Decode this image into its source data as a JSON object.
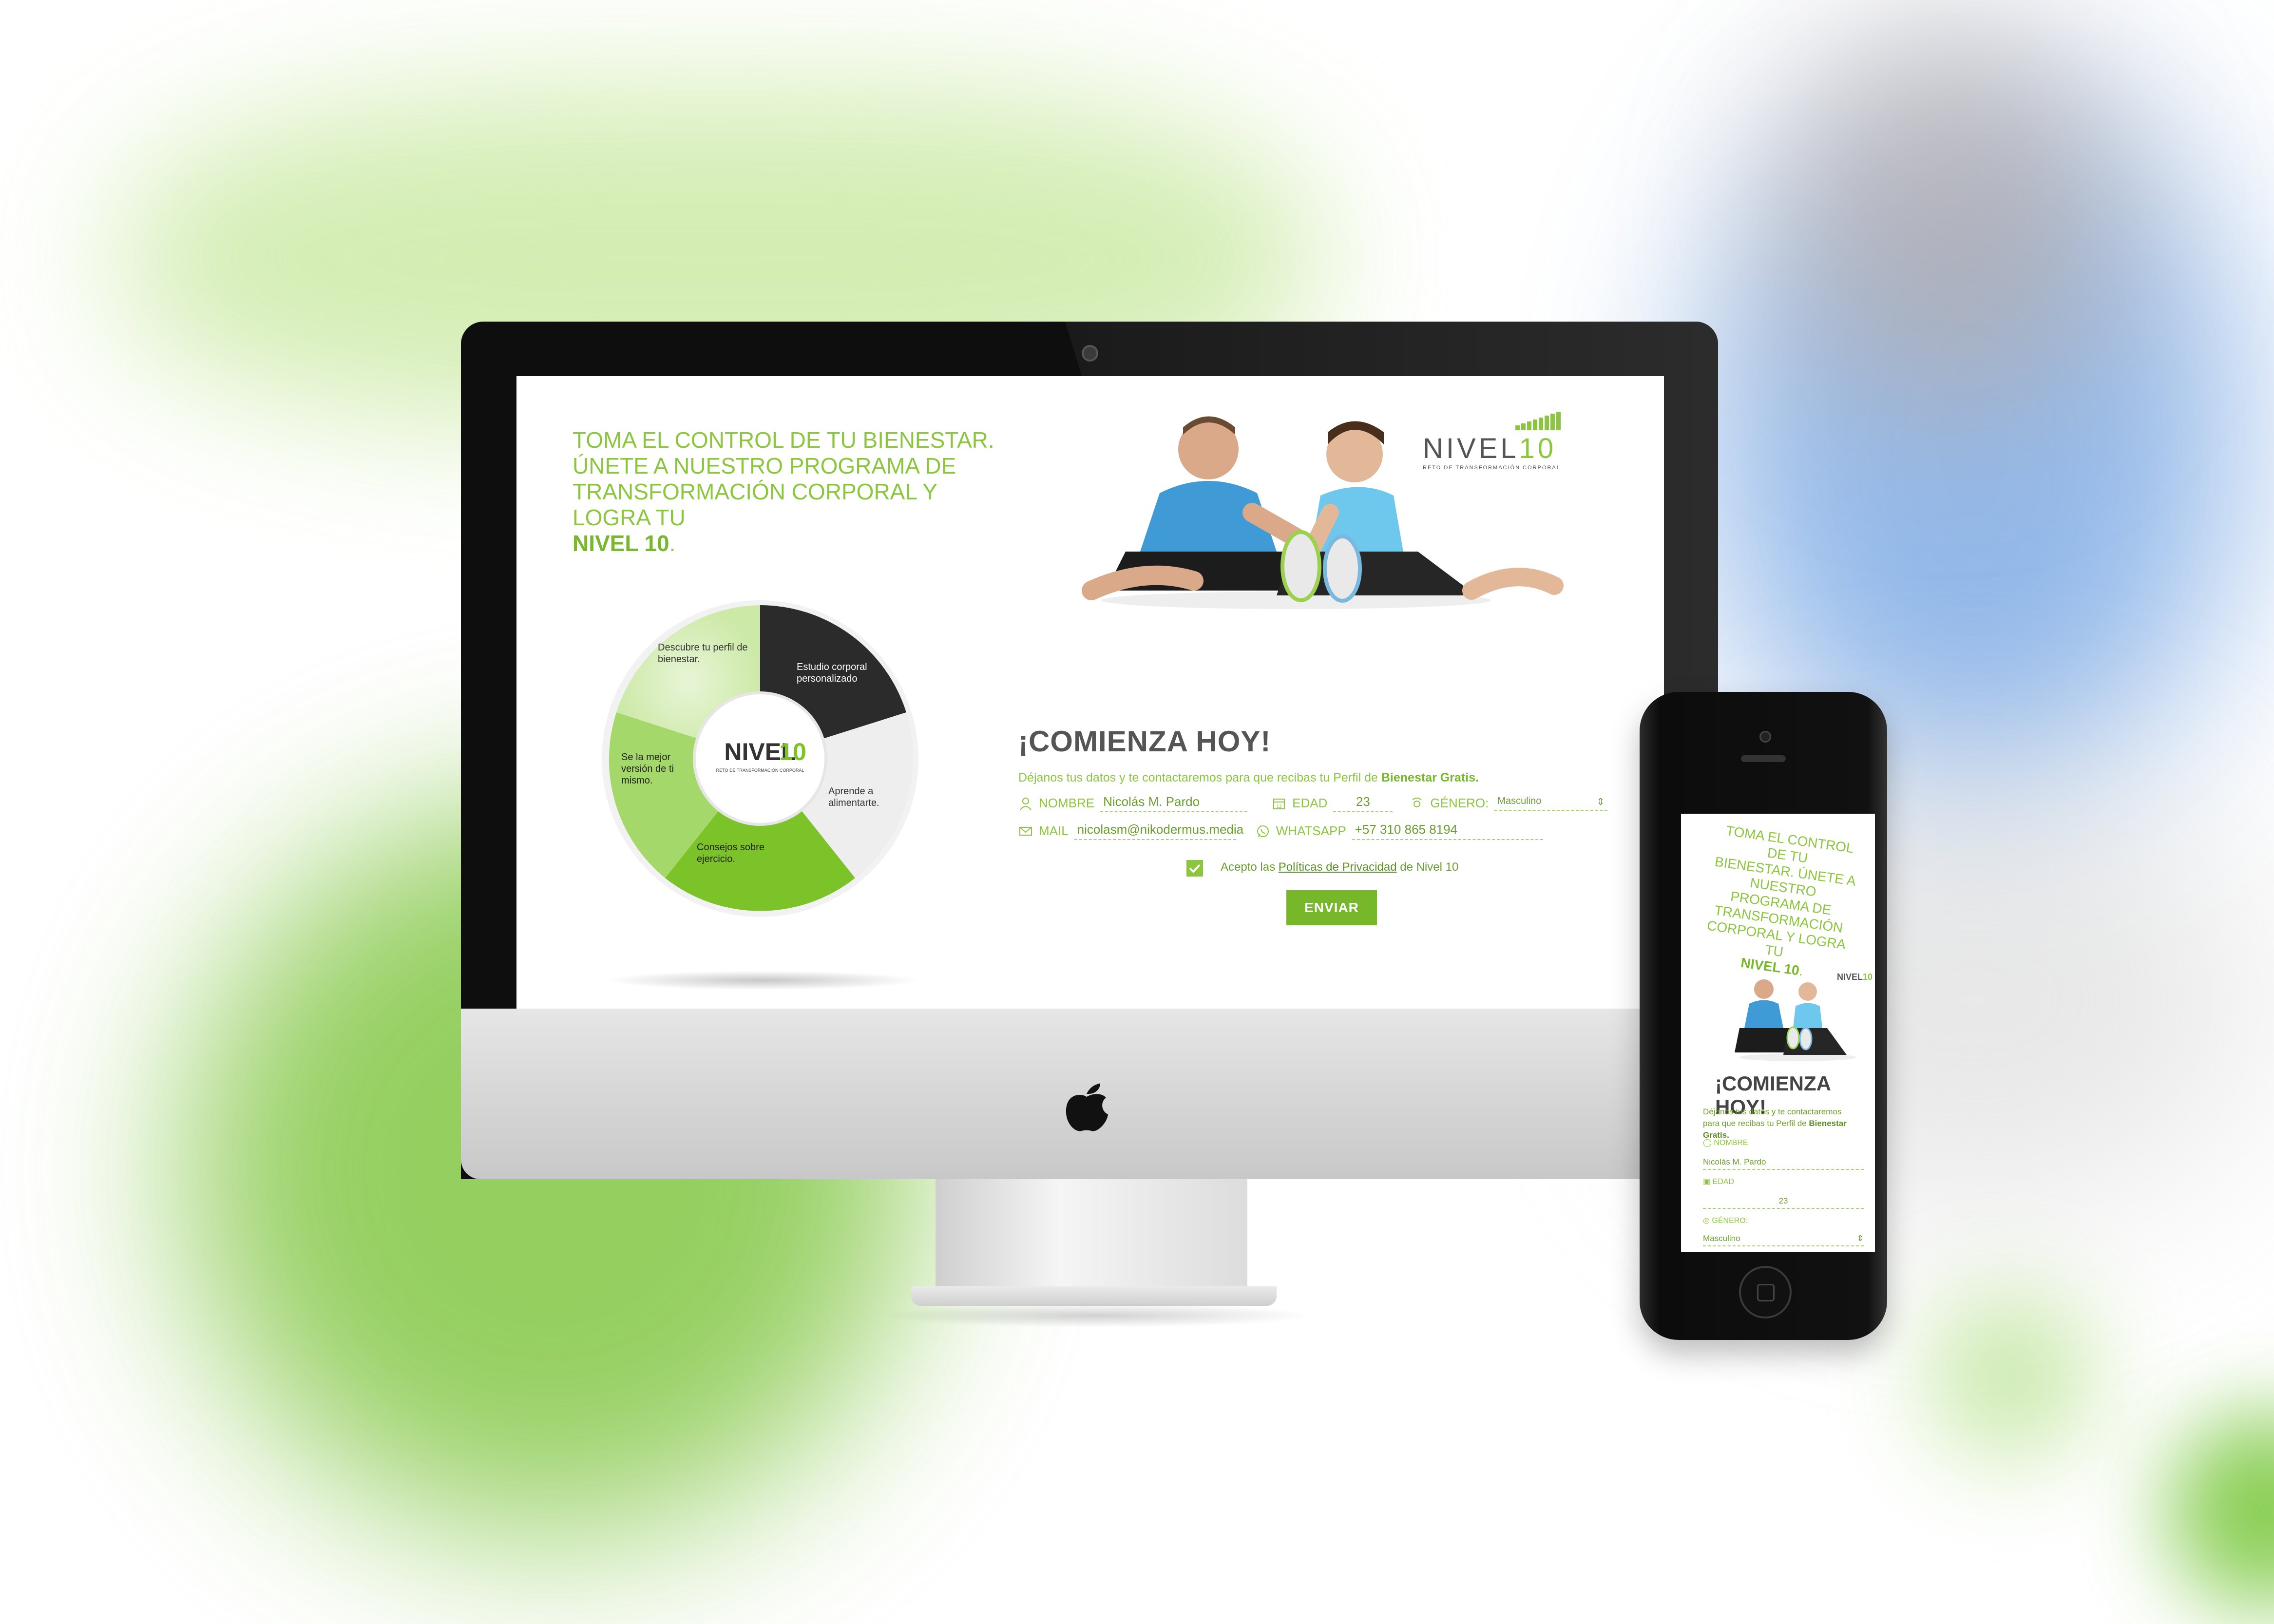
{
  "desktop": {
    "headline": {
      "line1": "TOMA EL CONTROL DE TU BIENESTAR.",
      "line2": "ÚNETE A NUESTRO PROGRAMA DE",
      "line3": "TRANSFORMACIÓN CORPORAL Y LOGRA TU",
      "line4_bold": "NIVEL 10",
      "line4_end": "."
    },
    "logo": {
      "word": "NIVEL",
      "number": "10",
      "tagline": "RETO DE TRANSFORMACIÓN CORPORAL"
    },
    "wheel": {
      "segments": [
        "Descubre tu perfil de bienestar.",
        "Estudio corporal personalizado",
        "Aprende a alimentarte.",
        "Consejos sobre ejercicio.",
        "Se la mejor versión de ti mismo."
      ],
      "center_word": "NIVEL",
      "center_number": "10",
      "center_tagline": "RETO DE TRANSFORMACIÓN CORPORAL"
    },
    "cta": "¡COMIENZA HOY!",
    "intro": {
      "text": "Déjanos tus datos y te contactaremos para que recibas tu Perfil de",
      "bold": "Bienestar Gratis."
    },
    "form": {
      "nombre_label": "NOMBRE",
      "nombre_value": "Nicolás M. Pardo",
      "edad_label": "EDAD",
      "edad_value": "23",
      "genero_label": "GÉNERO:",
      "genero_value": "Masculino",
      "mail_label": "MAIL",
      "mail_value": "nicolasm@nikodermus.media",
      "whatsapp_label": "WHATSAPP",
      "whatsapp_value": "+57 310 865 8194"
    },
    "accept": {
      "prefix": "Acepto las",
      "link": "Políticas de Privacidad",
      "suffix": "de Nivel 10"
    },
    "send_label": "ENVIAR"
  },
  "mobile": {
    "headline": {
      "line1": "TOMA EL CONTROL DE TU",
      "line2": "BIENESTAR. ÚNETE A",
      "line3": "NUESTRO PROGRAMA DE",
      "line4": "TRANSFORMACIÓN",
      "line5": "CORPORAL Y LOGRA TU",
      "line6_bold": "NIVEL 10",
      "line6_end": "."
    },
    "logo_word": "NIVEL",
    "logo_number": "10",
    "cta": "¡COMIENZA HOY!",
    "intro": {
      "text": "Déjanos tus datos y te contactaremos para que recibas tu Perfil de",
      "bold": "Bienestar Gratis."
    },
    "nombre_label": "NOMBRE",
    "nombre_value": "Nicolás M. Pardo",
    "edad_label": "EDAD",
    "edad_value": "23",
    "genero_label": "GÉNERO:",
    "genero_value": "Masculino"
  },
  "colors": {
    "accent": "#8cc63f",
    "accent_dark": "#77b82a",
    "text_dark": "#555555"
  }
}
